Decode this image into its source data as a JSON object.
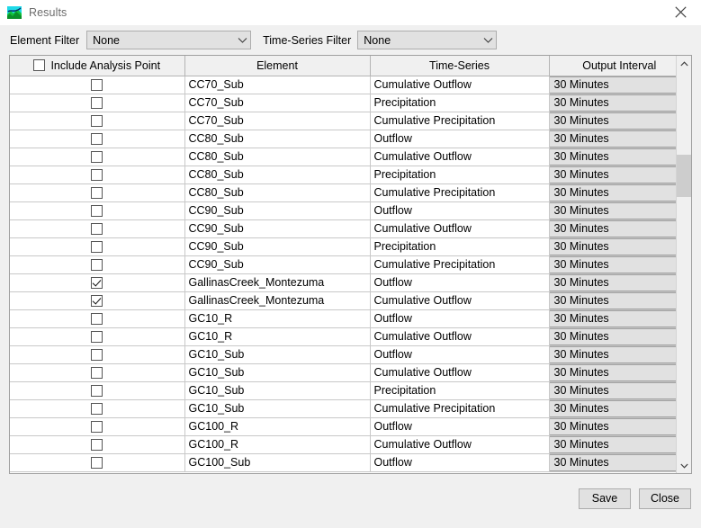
{
  "window": {
    "title": "Results",
    "icon": "map-landscape-icon",
    "close_icon": "close-icon"
  },
  "filters": {
    "element_filter_label": "Element Filter",
    "element_filter_value": "None",
    "timeseries_filter_label": "Time-Series Filter",
    "timeseries_filter_value": "None"
  },
  "table": {
    "headers": {
      "include": "Include Analysis Point",
      "element": "Element",
      "timeseries": "Time-Series",
      "interval": "Output Interval"
    },
    "header_checkbox_checked": false,
    "rows": [
      {
        "checked": false,
        "element": "CC70_Sub",
        "timeseries": "Cumulative Outflow",
        "interval": "30 Minutes"
      },
      {
        "checked": false,
        "element": "CC70_Sub",
        "timeseries": "Precipitation",
        "interval": "30 Minutes"
      },
      {
        "checked": false,
        "element": "CC70_Sub",
        "timeseries": "Cumulative Precipitation",
        "interval": "30 Minutes"
      },
      {
        "checked": false,
        "element": "CC80_Sub",
        "timeseries": "Outflow",
        "interval": "30 Minutes"
      },
      {
        "checked": false,
        "element": "CC80_Sub",
        "timeseries": "Cumulative Outflow",
        "interval": "30 Minutes"
      },
      {
        "checked": false,
        "element": "CC80_Sub",
        "timeseries": "Precipitation",
        "interval": "30 Minutes"
      },
      {
        "checked": false,
        "element": "CC80_Sub",
        "timeseries": "Cumulative Precipitation",
        "interval": "30 Minutes"
      },
      {
        "checked": false,
        "element": "CC90_Sub",
        "timeseries": "Outflow",
        "interval": "30 Minutes"
      },
      {
        "checked": false,
        "element": "CC90_Sub",
        "timeseries": "Cumulative Outflow",
        "interval": "30 Minutes"
      },
      {
        "checked": false,
        "element": "CC90_Sub",
        "timeseries": "Precipitation",
        "interval": "30 Minutes"
      },
      {
        "checked": false,
        "element": "CC90_Sub",
        "timeseries": "Cumulative Precipitation",
        "interval": "30 Minutes"
      },
      {
        "checked": true,
        "element": "GallinasCreek_Montezuma",
        "timeseries": "Outflow",
        "interval": "30 Minutes"
      },
      {
        "checked": true,
        "element": "GallinasCreek_Montezuma",
        "timeseries": "Cumulative Outflow",
        "interval": "30 Minutes"
      },
      {
        "checked": false,
        "element": "GC10_R",
        "timeseries": "Outflow",
        "interval": "30 Minutes"
      },
      {
        "checked": false,
        "element": "GC10_R",
        "timeseries": "Cumulative Outflow",
        "interval": "30 Minutes"
      },
      {
        "checked": false,
        "element": "GC10_Sub",
        "timeseries": "Outflow",
        "interval": "30 Minutes"
      },
      {
        "checked": false,
        "element": "GC10_Sub",
        "timeseries": "Cumulative Outflow",
        "interval": "30 Minutes"
      },
      {
        "checked": false,
        "element": "GC10_Sub",
        "timeseries": "Precipitation",
        "interval": "30 Minutes"
      },
      {
        "checked": false,
        "element": "GC10_Sub",
        "timeseries": "Cumulative Precipitation",
        "interval": "30 Minutes"
      },
      {
        "checked": false,
        "element": "GC100_R",
        "timeseries": "Outflow",
        "interval": "30 Minutes"
      },
      {
        "checked": false,
        "element": "GC100_R",
        "timeseries": "Cumulative Outflow",
        "interval": "30 Minutes"
      },
      {
        "checked": false,
        "element": "GC100_Sub",
        "timeseries": "Outflow",
        "interval": "30 Minutes"
      }
    ]
  },
  "scrollbar": {
    "up_icon": "chevron-up-icon",
    "down_icon": "chevron-down-icon"
  },
  "footer": {
    "save_label": "Save",
    "close_label": "Close"
  },
  "colors": {
    "dialog_bg": "#f0f0f0",
    "grid_bg": "#ffffff",
    "control_bg": "#e1e1e1",
    "border": "#a0a0a0",
    "title_text": "#6b6b6b"
  }
}
